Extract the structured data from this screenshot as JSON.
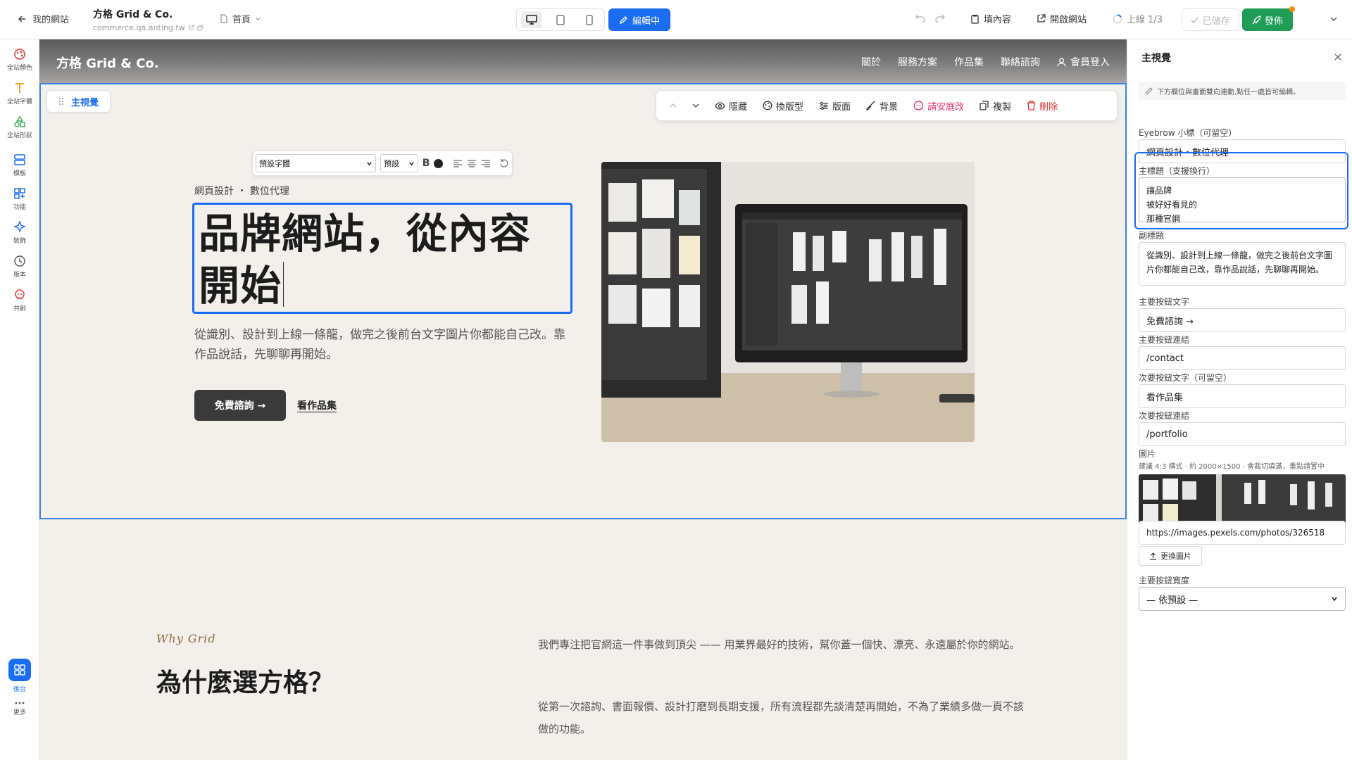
{
  "topbar": {
    "back_label": "我的網站",
    "site_name": "方格 Grid & Co.",
    "site_url": "commerce.qa.anting.tw",
    "page_label": "首頁",
    "edit_label": "編輯中",
    "content_label": "填內容",
    "open_site_label": "開啟網站",
    "progress_label": "上線 1/3",
    "saved_label": "已儲存",
    "publish_label": "發佈"
  },
  "sidebar": {
    "items": [
      {
        "label": "全站顏色",
        "icon": "palette-icon"
      },
      {
        "label": "全站字體",
        "icon": "font-icon"
      },
      {
        "label": "全站形狀",
        "icon": "shapes-icon"
      },
      {
        "label": "模板",
        "icon": "template-icon"
      },
      {
        "label": "功能",
        "icon": "features-icon"
      },
      {
        "label": "裝飾",
        "icon": "sparkle-icon"
      },
      {
        "label": "版本",
        "icon": "history-icon"
      },
      {
        "label": "共創",
        "icon": "cocreate-icon"
      }
    ],
    "admin_label": "後台",
    "more_label": "更多"
  },
  "site": {
    "logo": "方格 Grid & Co.",
    "nav": [
      "關於",
      "服務方案",
      "作品集",
      "聯絡諮詢"
    ],
    "member_login": "會員登入"
  },
  "section_toolbar": {
    "section_name": "主視覺",
    "hide": "隱藏",
    "variant": "換版型",
    "layout": "版面",
    "background": "背景",
    "ask_ai": "請安庭改",
    "duplicate": "複製",
    "delete": "刪除"
  },
  "format_bar": {
    "font": "預設字體",
    "size": "預設"
  },
  "hero": {
    "eyebrow": "網頁設計 ・ 數位代理",
    "title_line1": "品牌網站，從內容",
    "title_line2": "開始",
    "subtitle": "從識別、設計到上線一條龍，做完之後前台文字圖片你都能自己改。靠作品說話，先聊聊再開始。",
    "cta_primary": "免費諮詢 →",
    "cta_secondary": "看作品集"
  },
  "why": {
    "eyebrow": "Why Grid",
    "title": "為什麼選方格？",
    "p1": "我們專注把官網這一件事做到頂尖 —— 用業界最好的技術，幫你蓋一個快、漂亮、永遠屬於你的網站。",
    "p2": "從第一次諮詢、書面報價、設計打磨到長期支援，所有流程都先談清楚再開始，不為了業績多做一頁不該做的功能。"
  },
  "panel": {
    "title": "主視覺",
    "note": "下方欄位與畫面雙向連動,點任一處皆可編輯。",
    "eyebrow_label": "Eyebrow 小標（可留空）",
    "eyebrow_value": "網頁設計・數位代理",
    "title_label": "主標題（支援換行）",
    "title_value": "讓品牌\n被好好看見的\n那種官網",
    "subtitle_label": "副標題",
    "subtitle_value": "從識別、設計到上線一條龍，做完之後前台文字圖片你都能自己改，靠作品說話，先聊聊再開始。",
    "cta1_text_label": "主要按鈕文字",
    "cta1_text_value": "免費諮詢 →",
    "cta1_link_label": "主要按鈕連結",
    "cta1_link_value": "/contact",
    "cta2_text_label": "次要按鈕文字（可留空）",
    "cta2_text_value": "看作品集",
    "cta2_link_label": "次要按鈕連結",
    "cta2_link_value": "/portfolio",
    "image_label": "圖片",
    "image_hint": "建議 4:3 橫式 · 約 2000×1500 · 會裁切填滿，重點請置中",
    "image_url": "https://images.pexels.com/photos/326518",
    "replace_image": "更換圖片",
    "cta_width_label": "主要按鈕寬度",
    "cta_width_value": "— 依預設 —"
  },
  "colors": {
    "accent": "#1a6cf0",
    "publish": "#1f9d57",
    "ai": "#e6336b",
    "danger": "#e02b2b"
  }
}
